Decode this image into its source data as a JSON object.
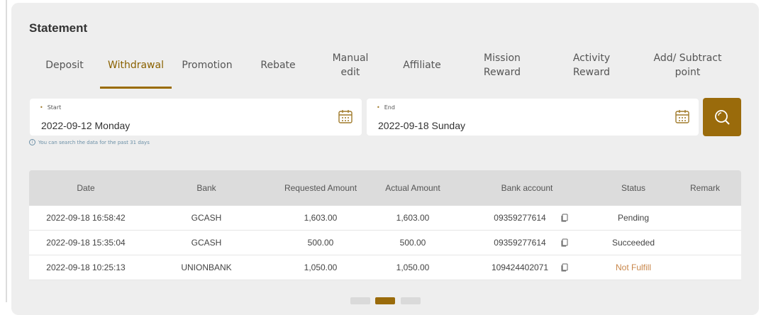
{
  "statement": {
    "title": "Statement",
    "tabs": [
      {
        "label": "Deposit"
      },
      {
        "label": "Withdrawal"
      },
      {
        "label": "Promotion"
      },
      {
        "label": "Rebate"
      },
      {
        "label": "Manual\nedit"
      },
      {
        "label": "Affiliate"
      },
      {
        "label": "Mission\nReward"
      },
      {
        "label": "Activity\nReward"
      },
      {
        "label": "Add/ Subtract\npoint"
      }
    ],
    "active_tab": "Withdrawal"
  },
  "filters": {
    "start": {
      "label": "Start",
      "value": "2022-09-12 Monday"
    },
    "end": {
      "label": "End",
      "value": "2022-09-18 Sunday"
    },
    "hint": "You can search the data for the past 31 days",
    "search_icon": "search-icon"
  },
  "table": {
    "headers": [
      "Date",
      "Bank",
      "Requested Amount",
      "Actual Amount",
      "Bank account",
      "Status",
      "Remark"
    ],
    "rows": [
      {
        "date": "2022-09-18 16:58:42",
        "bank": "GCASH",
        "requested": "1,603.00",
        "actual": "1,603.00",
        "account": "09359277614",
        "status": "Pending",
        "remark": ""
      },
      {
        "date": "2022-09-18 15:35:04",
        "bank": "GCASH",
        "requested": "500.00",
        "actual": "500.00",
        "account": "09359277614",
        "status": "Succeeded",
        "remark": ""
      },
      {
        "date": "2022-09-18 10:25:13",
        "bank": "UNIONBANK",
        "requested": "1,050.00",
        "actual": "1,050.00",
        "account": "109424402071",
        "status": "Not Fulfill",
        "remark": ""
      }
    ]
  },
  "colors": {
    "accent": "#9a6b0b",
    "warning_status": "#c8864a"
  }
}
